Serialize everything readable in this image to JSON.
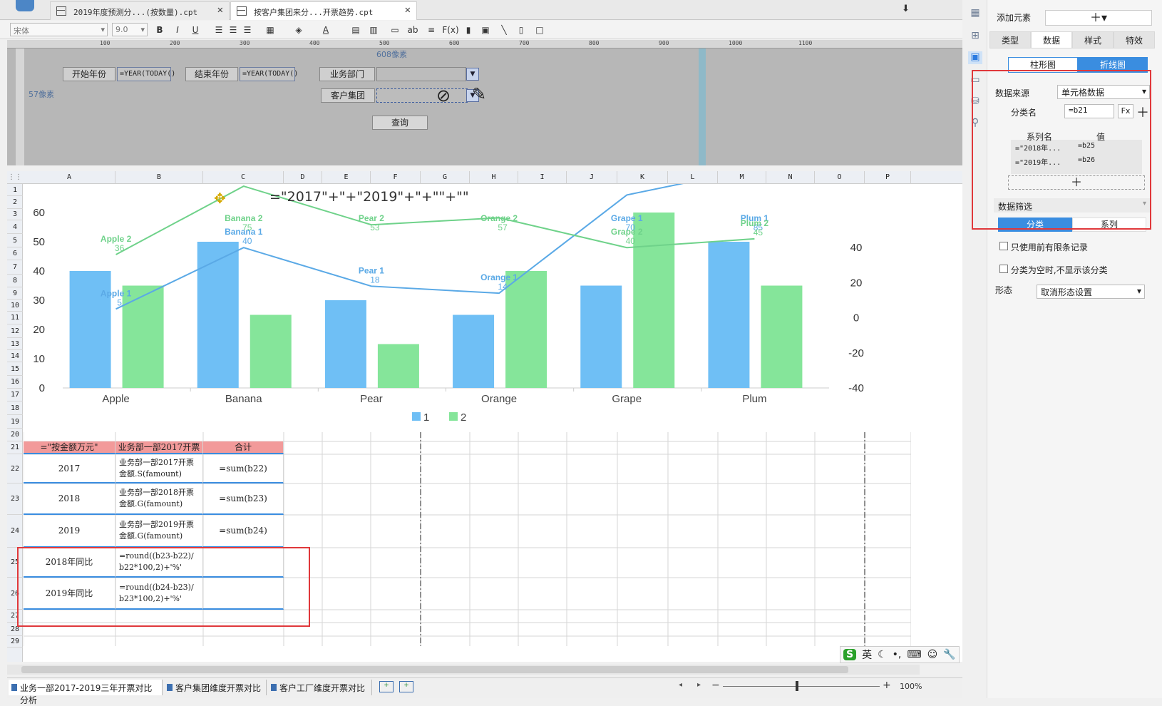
{
  "tabs": [
    {
      "label": "2019年度预测分...(按数量).cpt"
    },
    {
      "label": "按客户集团来分...开票趋势.cpt"
    }
  ],
  "toolbar": {
    "font": "宋体",
    "size": "9.0",
    "bold": "B",
    "italic": "I",
    "underline": "U",
    "fx": "F(x)",
    "ab": "ab"
  },
  "ruler_marks": [
    "100",
    "200",
    "300",
    "400",
    "500",
    "600",
    "700",
    "800",
    "900",
    "1000",
    "1100"
  ],
  "params": {
    "width_note": "608像素",
    "height_note": "57像素",
    "start_year_label": "开始年份",
    "start_year_value": "=YEAR(TODAY()",
    "end_year_label": "结束年份",
    "end_year_value": "=YEAR(TODAY()",
    "dept_label": "业务部门",
    "group_label": "客户集团",
    "query_label": "查询"
  },
  "columns": [
    "A",
    "B",
    "C",
    "D",
    "E",
    "F",
    "G",
    "H",
    "I",
    "J",
    "K",
    "L",
    "M",
    "N",
    "O",
    "P"
  ],
  "rows": [
    "1",
    "2",
    "3",
    "4",
    "5",
    "6",
    "7",
    "8",
    "9",
    "10",
    "11",
    "12",
    "13",
    "14",
    "15",
    "16",
    "17",
    "18",
    "19",
    "20",
    "21",
    "22",
    "23",
    "24",
    "25",
    "26",
    "27",
    "28",
    "29"
  ],
  "chart_data": {
    "type": "bar",
    "title": "=\"2017\"+\"+\"2019\"+\"+\"\"+\"\"",
    "categories": [
      "Apple",
      "Banana",
      "Pear",
      "Orange",
      "Grape",
      "Plum"
    ],
    "series": [
      {
        "name": "1",
        "values": [
          40,
          50,
          30,
          25,
          35,
          50
        ],
        "color": "#6fbff5"
      },
      {
        "name": "2",
        "values": [
          35,
          25,
          15,
          40,
          60,
          35
        ],
        "color": "#85e59a"
      }
    ],
    "line_series": [
      {
        "name": "1",
        "values": [
          5,
          40,
          18,
          14,
          70,
          85
        ],
        "color": "#5aa9e6"
      },
      {
        "name": "2",
        "values": [
          36,
          75,
          53,
          57,
          40,
          45
        ],
        "color": "#6fd28a"
      }
    ],
    "ylim": [
      0,
      60
    ],
    "yticks": [
      0,
      10,
      20,
      30,
      40,
      50,
      60
    ],
    "y2lim": [
      -40,
      60
    ],
    "y2ticks": [
      -40,
      -20,
      0,
      20,
      40
    ],
    "legend": "bottom"
  },
  "table": {
    "header": [
      "=\"按金额万元\"",
      "业务部一部2017开票",
      "合计"
    ],
    "rows": [
      [
        "2017",
        "业务部一部2017开票\n金额.S(famount)",
        "=sum(b22)"
      ],
      [
        "2018",
        "业务部一部2018开票\n金额.G(famount)",
        "=sum(b23)"
      ],
      [
        "2019",
        "业务部一部2019开票\n金额.G(famount)",
        "=sum(b24)"
      ],
      [
        "2018年同比",
        "=round((b23-b22)/\nb22*100,2)+'%'",
        ""
      ],
      [
        "2019年同比",
        "=round((b24-b23)/\nb23*100,2)+'%'",
        ""
      ]
    ]
  },
  "sheet_tabs": [
    "业务一部2017-2019三年开票对比分析",
    "客户集团维度开票对比",
    "客户工厂维度开票对比"
  ],
  "zoom": "100%",
  "ime": {
    "lang": "英"
  },
  "panel": {
    "add_element": "添加元素",
    "tabs": [
      "类型",
      "数据",
      "样式",
      "特效"
    ],
    "chart_types": [
      "柱形图",
      "折线图"
    ],
    "source_label": "数据来源",
    "source_value": "单元格数据",
    "category_label": "分类名",
    "category_value": "=b21",
    "series_hdr": "系列名",
    "value_hdr": "值",
    "series": [
      {
        "name": "=\"2018年...",
        "value": "=b25"
      },
      {
        "name": "=\"2019年...",
        "value": "=b26"
      }
    ],
    "filter_title": "数据筛选",
    "filter_tabs": [
      "分类",
      "系列"
    ],
    "opt1": "只使用前有限条记录",
    "opt2": "分类为空时,不显示该分类",
    "state_label": "形态",
    "state_value": "取消形态设置"
  }
}
